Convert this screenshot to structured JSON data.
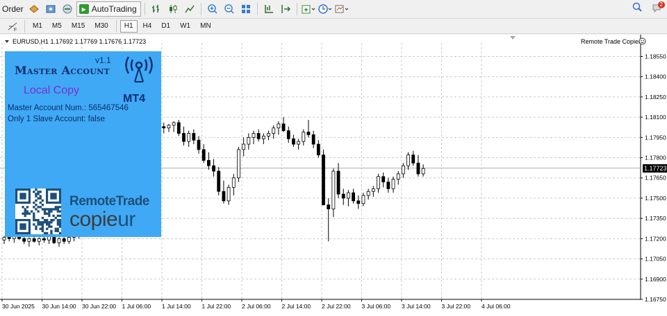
{
  "toolbar": {
    "order_label": "Order",
    "autotrading_label": "AutoTrading",
    "notification_count": "2"
  },
  "timeframes": [
    "M1",
    "M5",
    "M15",
    "M30",
    "H1",
    "H4",
    "D1",
    "W1",
    "MN"
  ],
  "active_timeframe": "H1",
  "chart": {
    "symbol_info": "EURUSD,H1  1.17692 1.17769 1.17676 1.17723",
    "ea_name": "Remote Trade Copier",
    "current_price": "1.17723",
    "bg_color": "#ffffff",
    "bull_color": "#ffffff",
    "bear_color": "#000000"
  },
  "panel": {
    "title": "Master Account",
    "version": "v1.1",
    "subtitle": "Local Copy",
    "platform": "MT4",
    "info_master": "Master Account Num.:  565467546",
    "info_slave": "Only 1 Slave Account:  false",
    "brand_line1": "RemoteTrade",
    "brand_line2_a": "copie",
    "brand_line2_b": "ur",
    "bg_color": "#3fa9f5"
  },
  "chart_data": {
    "type": "candlestick",
    "title": "",
    "symbol": "EURUSD",
    "timeframe": "H1",
    "ylim": [
      1.1675,
      1.1865
    ],
    "y_ticks": [
      1.1675,
      1.169,
      1.1705,
      1.172,
      1.1735,
      1.175,
      1.1765,
      1.178,
      1.1795,
      1.181,
      1.1825,
      1.184,
      1.1855
    ],
    "x_tick_labels": [
      "30 Jun 2025",
      "30 Jun 14:00",
      "30 Jun 22:00",
      "1 Jul 06:00",
      "1 Jul 14:00",
      "1 Jul 22:00",
      "2 Jul 06:00",
      "2 Jul 14:00",
      "2 Jul 22:00",
      "3 Jul 06:00",
      "3 Jul 14:00",
      "3 Jul 22:00",
      "4 Jul 06:00"
    ],
    "grid": true,
    "candles": [
      [
        1.1719,
        1.1722,
        1.1716,
        1.1721
      ],
      [
        1.1721,
        1.1724,
        1.1718,
        1.172
      ],
      [
        1.172,
        1.1723,
        1.1717,
        1.1722
      ],
      [
        1.1722,
        1.1724,
        1.1719,
        1.172
      ],
      [
        1.172,
        1.1722,
        1.1716,
        1.1718
      ],
      [
        1.1718,
        1.1721,
        1.1714,
        1.172
      ],
      [
        1.172,
        1.1724,
        1.1717,
        1.1718
      ],
      [
        1.1718,
        1.1721,
        1.1715,
        1.172
      ],
      [
        1.172,
        1.1722,
        1.1717,
        1.1719
      ],
      [
        1.1719,
        1.1723,
        1.1716,
        1.1722
      ],
      [
        1.1722,
        1.1724,
        1.1716,
        1.1717
      ],
      [
        1.1717,
        1.1721,
        1.1714,
        1.172
      ],
      [
        1.172,
        1.1723,
        1.1716,
        1.1718
      ],
      [
        1.1718,
        1.1722,
        1.1716,
        1.1721
      ],
      [
        1.1721,
        1.1725,
        1.1718,
        1.1723
      ],
      [
        1.1723,
        1.1727,
        1.172,
        1.1725
      ],
      [
        1.1725,
        1.1735,
        1.1723,
        1.1733
      ],
      [
        1.1733,
        1.1755,
        1.173,
        1.1752
      ],
      [
        1.1752,
        1.1775,
        1.1748,
        1.1772
      ],
      [
        1.1772,
        1.179,
        1.1768,
        1.1786
      ],
      [
        1.1786,
        1.18,
        1.1782,
        1.1796
      ],
      [
        1.1796,
        1.1808,
        1.1792,
        1.1804
      ],
      [
        1.1804,
        1.1812,
        1.1795,
        1.1808
      ],
      [
        1.1808,
        1.1814,
        1.1798,
        1.1802
      ],
      [
        1.1802,
        1.1806,
        1.179,
        1.1796
      ],
      [
        1.1796,
        1.1798,
        1.1776,
        1.178
      ],
      [
        1.178,
        1.1786,
        1.1769,
        1.1772
      ],
      [
        1.1772,
        1.178,
        1.1764,
        1.1767
      ],
      [
        1.1767,
        1.1772,
        1.1762,
        1.177
      ],
      [
        1.177,
        1.1785,
        1.1766,
        1.1783
      ],
      [
        1.1783,
        1.1806,
        1.178,
        1.1804
      ],
      [
        1.1804,
        1.1807,
        1.1799,
        1.1803
      ],
      [
        1.1803,
        1.1806,
        1.1798,
        1.1802
      ],
      [
        1.1802,
        1.1805,
        1.1799,
        1.1804
      ],
      [
        1.1804,
        1.1807,
        1.1799,
        1.1806
      ],
      [
        1.1806,
        1.1808,
        1.1796,
        1.1798
      ],
      [
        1.1798,
        1.1803,
        1.1789,
        1.1792
      ],
      [
        1.1792,
        1.18,
        1.1788,
        1.1798
      ],
      [
        1.1798,
        1.1801,
        1.179,
        1.1793
      ],
      [
        1.1793,
        1.1796,
        1.1783,
        1.1786
      ],
      [
        1.1786,
        1.179,
        1.1776,
        1.1778
      ],
      [
        1.1778,
        1.1784,
        1.1771,
        1.1774
      ],
      [
        1.1774,
        1.1779,
        1.1766,
        1.177
      ],
      [
        1.177,
        1.1773,
        1.1752,
        1.1755
      ],
      [
        1.1755,
        1.1763,
        1.1746,
        1.1748
      ],
      [
        1.1748,
        1.176,
        1.1745,
        1.1758
      ],
      [
        1.1758,
        1.1768,
        1.1752,
        1.1765
      ],
      [
        1.1765,
        1.1788,
        1.1762,
        1.1786
      ],
      [
        1.1786,
        1.1795,
        1.1781,
        1.179
      ],
      [
        1.179,
        1.1798,
        1.1786,
        1.1795
      ],
      [
        1.1795,
        1.18,
        1.179,
        1.1798
      ],
      [
        1.1798,
        1.1801,
        1.1792,
        1.1794
      ],
      [
        1.1794,
        1.1798,
        1.179,
        1.1796
      ],
      [
        1.1796,
        1.18,
        1.1793,
        1.1798
      ],
      [
        1.1798,
        1.1804,
        1.1794,
        1.1802
      ],
      [
        1.1802,
        1.1807,
        1.1797,
        1.1805
      ],
      [
        1.1805,
        1.181,
        1.1799,
        1.18
      ],
      [
        1.18,
        1.1803,
        1.1791,
        1.1794
      ],
      [
        1.1794,
        1.1797,
        1.1788,
        1.179
      ],
      [
        1.179,
        1.1794,
        1.1786,
        1.1792
      ],
      [
        1.1792,
        1.1801,
        1.1789,
        1.1799
      ],
      [
        1.1799,
        1.1808,
        1.1795,
        1.1797
      ],
      [
        1.1797,
        1.18,
        1.1787,
        1.179
      ],
      [
        1.179,
        1.1793,
        1.178,
        1.1782
      ],
      [
        1.1782,
        1.1786,
        1.177,
        1.1745
      ],
      [
        1.1745,
        1.175,
        1.1718,
        1.1742
      ],
      [
        1.1742,
        1.1772,
        1.1736,
        1.177
      ],
      [
        1.177,
        1.1776,
        1.175,
        1.1753
      ],
      [
        1.1753,
        1.1757,
        1.1745,
        1.175
      ],
      [
        1.175,
        1.1756,
        1.1744,
        1.1754
      ],
      [
        1.1754,
        1.1757,
        1.1746,
        1.1748
      ],
      [
        1.1748,
        1.1752,
        1.1742,
        1.1746
      ],
      [
        1.1746,
        1.1754,
        1.1744,
        1.1752
      ],
      [
        1.1752,
        1.1757,
        1.1749,
        1.1755
      ],
      [
        1.1755,
        1.1759,
        1.1751,
        1.1757
      ],
      [
        1.1757,
        1.1768,
        1.1754,
        1.1766
      ],
      [
        1.1766,
        1.1769,
        1.1758,
        1.1762
      ],
      [
        1.1762,
        1.1765,
        1.1754,
        1.1757
      ],
      [
        1.1757,
        1.1766,
        1.1754,
        1.1764
      ],
      [
        1.1764,
        1.177,
        1.176,
        1.1768
      ],
      [
        1.1768,
        1.1776,
        1.1765,
        1.1774
      ],
      [
        1.1774,
        1.1784,
        1.1771,
        1.1782
      ],
      [
        1.1782,
        1.1785,
        1.1774,
        1.1776
      ],
      [
        1.1776,
        1.1782,
        1.1766,
        1.1768
      ],
      [
        1.1768,
        1.1775,
        1.1766,
        1.1772
      ]
    ]
  }
}
